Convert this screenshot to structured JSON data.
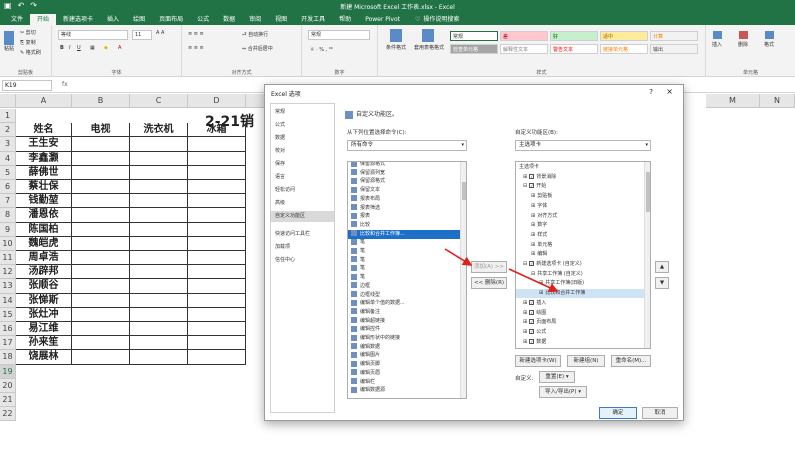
{
  "titlebar": {
    "title": "新建 Microsoft Excel 工作表.xlsx - Excel"
  },
  "tabs": [
    "文件",
    "开始",
    "新建选项卡",
    "插入",
    "绘图",
    "页面布局",
    "公式",
    "数据",
    "审阅",
    "视图",
    "开发工具",
    "帮助",
    "Power Pivot"
  ],
  "tell_me": "操作说明搜索",
  "ribbon": {
    "clipboard": {
      "cut": "剪切",
      "copy": "复制",
      "format_painter": "格式刷",
      "paste": "粘贴",
      "caption": "剪贴板"
    },
    "font": {
      "font_name": "等线",
      "font_size": "11",
      "caption": "字体"
    },
    "alignment": {
      "wrap": "自动换行",
      "merge": "合并后居中",
      "caption": "对齐方式"
    },
    "number": {
      "format": "常规",
      "caption": "数字"
    },
    "styles": {
      "cond_format": "条件格式",
      "table_format": "套用表格格式",
      "cells": [
        "常规",
        "差",
        "好",
        "适中",
        "计算",
        "检查单元格",
        "解释性文本",
        "警告文本",
        "链接单元格",
        "输出"
      ],
      "caption": "样式"
    },
    "cells": {
      "insert": "插入",
      "delete": "删除",
      "format": "格式",
      "caption": "单元格"
    }
  },
  "formula_bar": {
    "name_box": "K19",
    "fx": "fx"
  },
  "sheet": {
    "columns": [
      "A",
      "B",
      "C",
      "D",
      "E",
      "M",
      "N"
    ],
    "rows": [
      "1",
      "2",
      "3",
      "4",
      "5",
      "6",
      "7",
      "8",
      "9",
      "10",
      "11",
      "12",
      "13",
      "14",
      "15",
      "16",
      "17",
      "18",
      "19",
      "20",
      "21",
      "22"
    ],
    "title": "2-21销",
    "headers": [
      "姓名",
      "电视",
      "洗衣机",
      "冰箱"
    ],
    "names": [
      "王生安",
      "李鑫灏",
      "薛佛世",
      "蔡壮保",
      "钱勤堃",
      "潘恩依",
      "陈国柏",
      "魏皑虎",
      "周卓浩",
      "汤辟邦",
      "张顺谷",
      "张悌斯",
      "张灶冲",
      "易江维",
      "孙来笙",
      "饶展林"
    ]
  },
  "dialog": {
    "title": "Excel 选项",
    "help": "?",
    "close": "×",
    "nav": [
      "常规",
      "公式",
      "数据",
      "校对",
      "保存",
      "语言",
      "轻松访问",
      "高级",
      "自定义功能区",
      "快速访问工具栏",
      "加载项",
      "信任中心"
    ],
    "nav_active_index": 8,
    "heading": "自定义功能区。",
    "choose_label": "从下列位置选择命令(C):",
    "choose_value": "所有命令",
    "customize_label": "自定义功能区(B):",
    "customize_value": "主选项卡",
    "commands": [
      "保留源格式",
      "保留源列宽",
      "保留源格式",
      "保留文本",
      "报表布局",
      "报表筛选",
      "报表",
      "比较",
      "比较和合并工作簿...",
      "笔",
      "笔",
      "笔",
      "笔",
      "笔",
      "边框",
      "边框线型",
      "编辑单个值的数据...",
      "编辑备注",
      "编辑超链接",
      "编辑控件",
      "编辑形状中的链接",
      "编辑数据",
      "编辑图片",
      "编辑页脚",
      "编辑页眉",
      "编辑栏",
      "编辑数据源"
    ],
    "selected_command_index": 8,
    "add_button": "添加(A) >>",
    "remove_button": "<< 删除(R)",
    "tree": [
      "主选项卡",
      "背景消除",
      "开始",
      "剪贴板",
      "字体",
      "对齐方式",
      "数字",
      "样式",
      "单元格",
      "编辑",
      "新建选项卡 (自定义)",
      "共享工作簿 (自定义)",
      "共享工作簿(旧版)",
      "比较和合并工作簿",
      "插入",
      "绘图",
      "页面布局",
      "公式",
      "数据"
    ],
    "tree_highlight_index": 13,
    "new_tab": "新建选项卡(W)",
    "new_group": "新建组(N)",
    "rename": "重命名(M)...",
    "customizations_label": "自定义:",
    "reset": "重置(E) ▾",
    "import_export": "导入/导出(P) ▾",
    "ok": "确定",
    "cancel": "取消"
  }
}
